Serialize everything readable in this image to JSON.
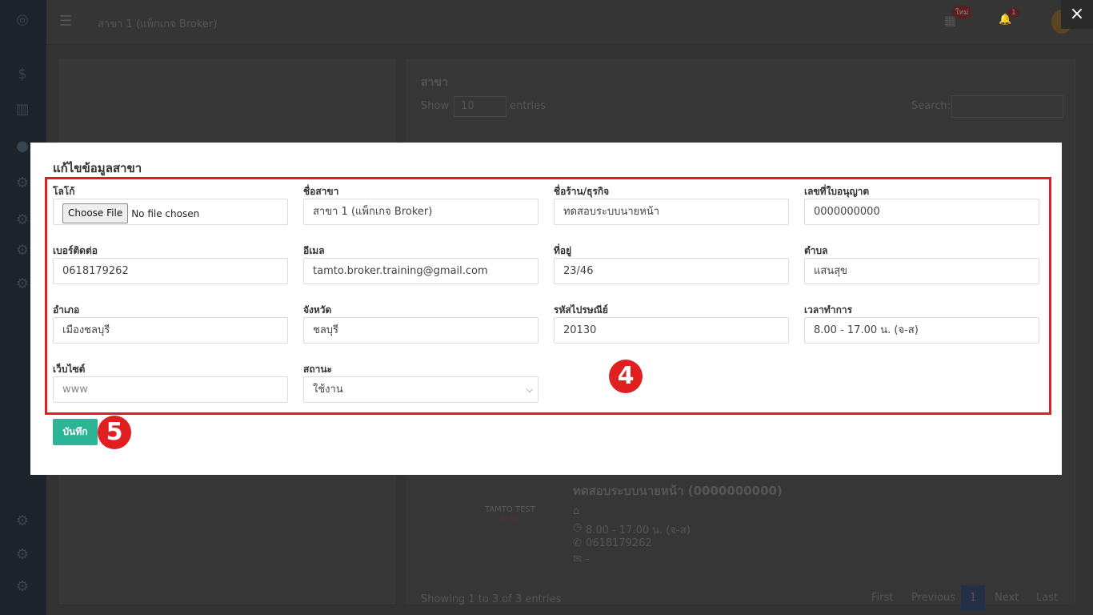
{
  "topbar": {
    "branch_selector": "สาขา 1 (แพ็กเกจ Broker)",
    "apps_badge": "ใหม่",
    "notif_badge": "1"
  },
  "background": {
    "section_title": "สาขา",
    "show_label": "Show",
    "entries_value": "10",
    "entries_label": "entries",
    "search_label": "Search:",
    "card": {
      "logo_text": "TAMTO TEST",
      "logo_sub": "BASIC",
      "name": "ทดสอบระบบนายหน้า (0000000000)",
      "hours": "8.00 - 17.00 น. (จ-ส)",
      "phone": "0618179262",
      "email": "-"
    },
    "info": "Showing 1 to 3 of 3 entries",
    "pagination": [
      "First",
      "Previous",
      "1",
      "Next",
      "Last"
    ]
  },
  "modal": {
    "title": "แก้ไขข้อมูลสาขา",
    "fields": [
      {
        "label": "โลโก้",
        "type": "file",
        "button": "Choose File",
        "status": "No file chosen"
      },
      {
        "label": "ชื่อสาขา",
        "value": "สาขา 1 (แพ็กเกจ Broker)"
      },
      {
        "label": "ชื่อร้าน/ธุรกิจ",
        "value": "ทดสอบระบบนายหน้า"
      },
      {
        "label": "เลขที่ใบอนุญาต",
        "value": "0000000000"
      },
      {
        "label": "เบอร์ติดต่อ",
        "value": "0618179262"
      },
      {
        "label": "อีเมล",
        "value": "tamto.broker.training@gmail.com"
      },
      {
        "label": "ที่อยู่",
        "value": "23/46"
      },
      {
        "label": "ตำบล",
        "value": "แสนสุข"
      },
      {
        "label": "อำเภอ",
        "value": "เมืองชลบุรี"
      },
      {
        "label": "จังหวัด",
        "value": "ชลบุรี"
      },
      {
        "label": "รหัสไปรษณีย์",
        "value": "20130"
      },
      {
        "label": "เวลาทำการ",
        "value": "8.00 - 17.00 น. (จ-ส)"
      },
      {
        "label": "เว็บไซต์",
        "value": "",
        "placeholder": "www"
      },
      {
        "label": "สถานะ",
        "type": "select",
        "value": "ใช้งาน"
      }
    ],
    "save_label": "บันทึก",
    "step_badges": [
      "4",
      "5"
    ],
    "accent_color": "#2bb596",
    "highlight_color": "#e02020"
  },
  "close_icon": "×"
}
